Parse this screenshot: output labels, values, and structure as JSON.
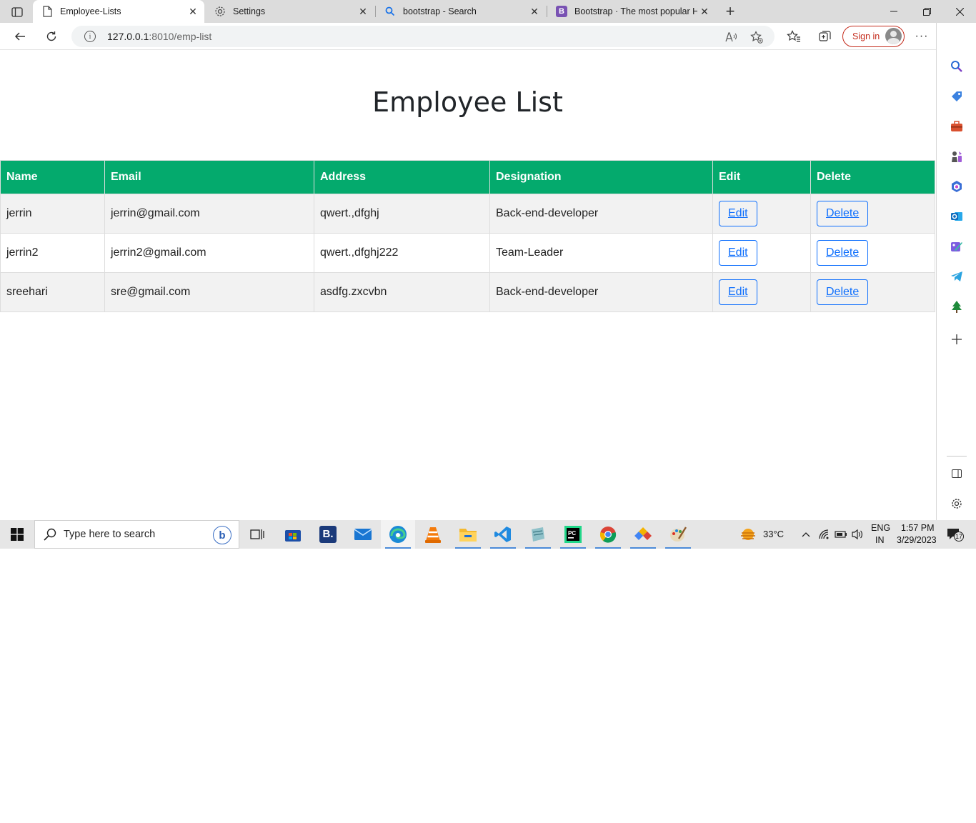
{
  "browser": {
    "tabs": [
      {
        "title": "Employee-Lists",
        "icon": "page-icon",
        "active": true
      },
      {
        "title": "Settings",
        "icon": "gear-icon",
        "active": false
      },
      {
        "title": "bootstrap - Search",
        "icon": "search-icon",
        "active": false
      },
      {
        "title": "Bootstrap · The most popular HT",
        "icon": "bootstrap-icon",
        "active": false
      }
    ],
    "url_host": "127.0.0.1",
    "url_path": ":8010/emp-list",
    "signin_label": "Sign in"
  },
  "page": {
    "title": "Employee List",
    "table": {
      "headers": [
        "Name",
        "Email",
        "Address",
        "Designation",
        "Edit",
        "Delete"
      ],
      "rows": [
        {
          "name": "jerrin",
          "email": "jerrin@gmail.com",
          "address": "qwert.,dfghj",
          "designation": "Back-end-developer",
          "edit": "Edit",
          "delete": "Delete"
        },
        {
          "name": "jerrin2",
          "email": "jerrin2@gmail.com",
          "address": "qwert.,dfghj222",
          "designation": "Team-Leader",
          "edit": "Edit",
          "delete": "Delete"
        },
        {
          "name": "sreehari",
          "email": "sre@gmail.com",
          "address": "asdfg.zxcvbn",
          "designation": "Back-end-developer",
          "edit": "Edit",
          "delete": "Delete"
        }
      ]
    },
    "colors": {
      "header_bg": "#04aa6d",
      "stripe_bg": "#f2f2f2",
      "button": "#0d6efd"
    }
  },
  "taskbar": {
    "search_placeholder": "Type here to search",
    "weather": "33°C",
    "lang_1": "ENG",
    "lang_2": "IN",
    "time": "1:57 PM",
    "date": "3/29/2023",
    "notifications": "17"
  }
}
